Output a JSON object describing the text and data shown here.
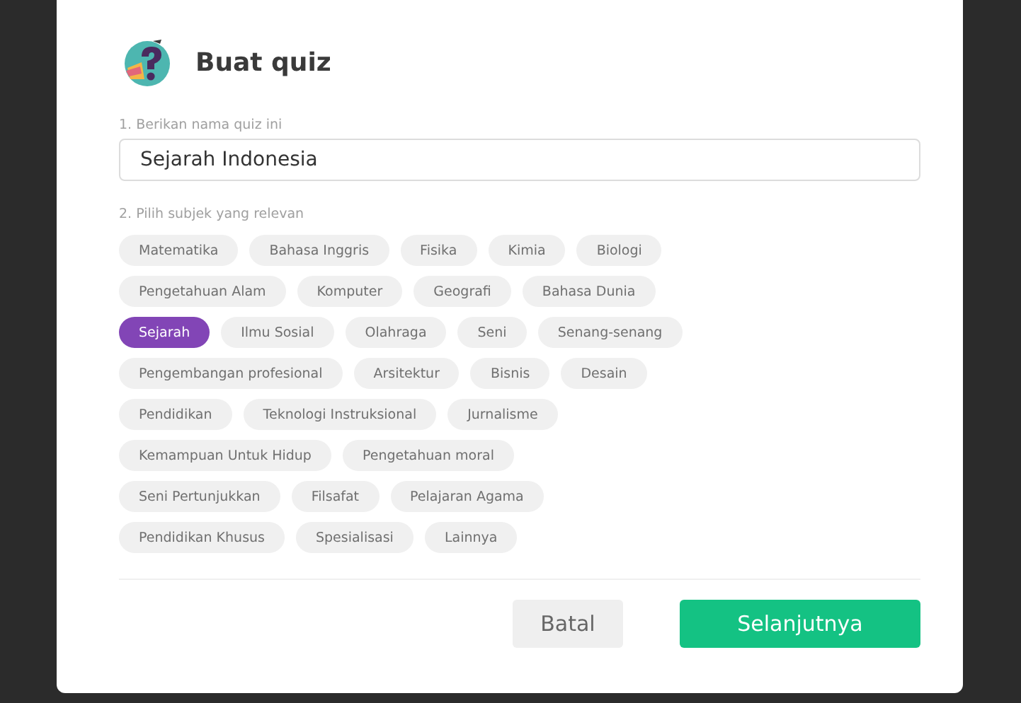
{
  "dialog": {
    "title": "Buat quiz",
    "name_field": {
      "label": "1. Berikan nama quiz ini",
      "value": "Sejarah Indonesia"
    },
    "subjects": {
      "label": "2. Pilih subjek yang relevan",
      "rows": [
        [
          {
            "label": "Matematika",
            "selected": false
          },
          {
            "label": "Bahasa Inggris",
            "selected": false
          },
          {
            "label": "Fisika",
            "selected": false
          },
          {
            "label": "Kimia",
            "selected": false
          },
          {
            "label": "Biologi",
            "selected": false
          }
        ],
        [
          {
            "label": "Pengetahuan Alam",
            "selected": false
          },
          {
            "label": "Komputer",
            "selected": false
          },
          {
            "label": "Geografi",
            "selected": false
          },
          {
            "label": "Bahasa Dunia",
            "selected": false
          }
        ],
        [
          {
            "label": "Sejarah",
            "selected": true
          },
          {
            "label": "Ilmu Sosial",
            "selected": false
          },
          {
            "label": "Olahraga",
            "selected": false
          },
          {
            "label": "Seni",
            "selected": false
          },
          {
            "label": "Senang-senang",
            "selected": false
          }
        ],
        [
          {
            "label": "Pengembangan profesional",
            "selected": false
          },
          {
            "label": "Arsitektur",
            "selected": false
          },
          {
            "label": "Bisnis",
            "selected": false
          },
          {
            "label": "Desain",
            "selected": false
          }
        ],
        [
          {
            "label": "Pendidikan",
            "selected": false
          },
          {
            "label": "Teknologi Instruksional",
            "selected": false
          },
          {
            "label": "Jurnalisme",
            "selected": false
          }
        ],
        [
          {
            "label": "Kemampuan Untuk Hidup",
            "selected": false
          },
          {
            "label": "Pengetahuan moral",
            "selected": false
          }
        ],
        [
          {
            "label": "Seni Pertunjukkan",
            "selected": false
          },
          {
            "label": "Filsafat",
            "selected": false
          },
          {
            "label": "Pelajaran Agama",
            "selected": false
          }
        ],
        [
          {
            "label": "Pendidikan Khusus",
            "selected": false
          },
          {
            "label": "Spesialisasi",
            "selected": false
          },
          {
            "label": "Lainnya",
            "selected": false
          }
        ]
      ]
    },
    "buttons": [
      {
        "label": "Batal",
        "kind": "secondary"
      },
      {
        "label": "Selanjutnya",
        "kind": "primary"
      }
    ]
  }
}
